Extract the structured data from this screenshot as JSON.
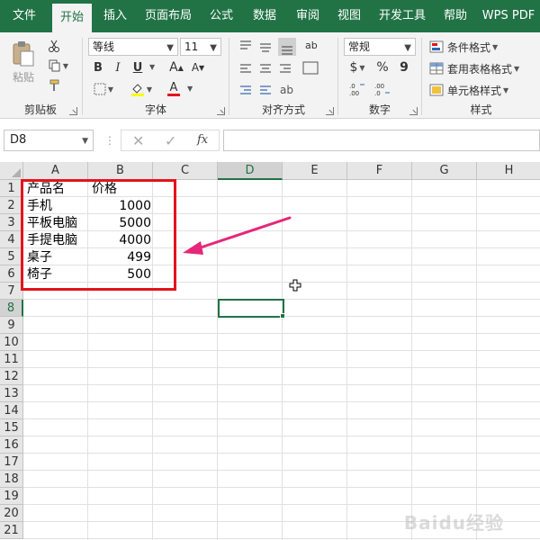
{
  "menu": {
    "items": [
      "文件",
      "开始",
      "插入",
      "页面布局",
      "公式",
      "数据",
      "审阅",
      "视图",
      "开发工具",
      "帮助",
      "WPS PDF"
    ],
    "active": "开始"
  },
  "ribbon": {
    "clipboard": {
      "label": "剪贴板",
      "paste": "粘贴"
    },
    "font": {
      "label": "字体",
      "family": "等线",
      "size": "11",
      "bold": "B",
      "italic": "I",
      "underline": "U",
      "grow": "A",
      "shrink": "A",
      "font_color_letter": "A"
    },
    "alignment": {
      "label": "对齐方式"
    },
    "number": {
      "label": "数字",
      "format": "常规",
      "currency": "$",
      "percent": "%",
      "comma": "9"
    },
    "styles": {
      "label": "样式",
      "conditional": "条件格式",
      "table": "套用表格格式",
      "cell": "单元格样式"
    }
  },
  "formula_bar": {
    "name_box": "D8",
    "fx": "fx",
    "value": ""
  },
  "columns": [
    "A",
    "B",
    "C",
    "D",
    "E",
    "F",
    "G",
    "H"
  ],
  "selected_column": "D",
  "rows": [
    "1",
    "2",
    "3",
    "4",
    "5",
    "6",
    "7",
    "8",
    "9",
    "10",
    "11",
    "12",
    "13",
    "14",
    "15",
    "16",
    "17",
    "18",
    "19",
    "20",
    "21"
  ],
  "selected_row": "8",
  "cells": {
    "a1": "产品名",
    "b1": "价格",
    "a2": "手机",
    "b2": "1000",
    "a3": "平板电脑",
    "b3": "5000",
    "a4": "手提电脑",
    "b4": "4000",
    "a5": "桌子",
    "b5": "499",
    "a6": "椅子",
    "b6": "500"
  },
  "annotation": {
    "box_color": "#e4141b",
    "arrow_color": "#e6267a"
  },
  "watermark": "Baidu经验",
  "colors": {
    "accent": "#217346"
  }
}
